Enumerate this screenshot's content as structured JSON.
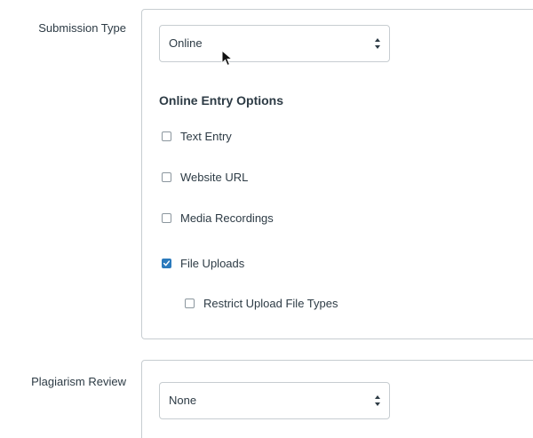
{
  "submission": {
    "label": "Submission Type",
    "select_value": "Online",
    "heading": "Online Entry Options",
    "options": [
      {
        "label": "Text Entry",
        "checked": false
      },
      {
        "label": "Website URL",
        "checked": false
      },
      {
        "label": "Media Recordings",
        "checked": false
      },
      {
        "label": "File Uploads",
        "checked": true
      },
      {
        "label": "Restrict Upload File Types",
        "checked": false
      }
    ]
  },
  "plagiarism": {
    "label": "Plagiarism Review",
    "select_value": "None"
  },
  "colors": {
    "accent": "#2b7abc",
    "border": "#c7cdd1",
    "text": "#2d3b45"
  },
  "icons": {
    "select_arrows": "up-down-arrows-icon",
    "checkmark": "checkmark-icon",
    "cursor": "mouse-pointer-icon"
  }
}
